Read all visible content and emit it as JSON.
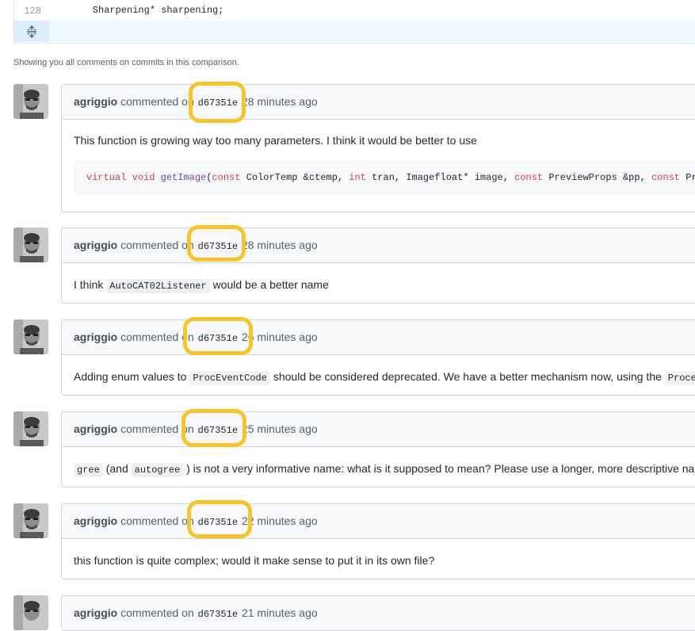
{
  "diff": {
    "line_number": "128",
    "code_line": "    Sharpening* sharpening;",
    "expand_icon": "unfold-icon"
  },
  "summary_text": "Showing you all comments on commits in this comparison.",
  "comments": [
    {
      "author": "agriggio",
      "action": "commented on",
      "sha": "d67351e",
      "time": "28 minutes ago",
      "text": "This function is growing way too many parameters. I think it would be better to use",
      "code": {
        "virtual": "virtual",
        "void": "void",
        "fn": "getImage",
        "p1": "(",
        "const1": "const",
        "t1": " ColorTemp &ctemp, ",
        "int": "int",
        "t2": " tran, Imagefloat* image, ",
        "const2": "const",
        "t3": " PreviewProps &pp, ",
        "const3": "const",
        "t4": " Pro"
      }
    },
    {
      "author": "agriggio",
      "action": "commented on",
      "sha": "d67351e",
      "time": "28 minutes ago",
      "text_before": "I think",
      "inline_code": "AutoCAT02Listener",
      "text_after": "would be a better name"
    },
    {
      "author": "agriggio",
      "action": "commented on",
      "sha": "d67351e",
      "time": "26 minutes ago",
      "text_before": "Adding enum values to",
      "inline_code": "ProcEventCode",
      "text_after": "should be considered deprecated. We have a better mechanism now, using the",
      "inline_code_2": "Proce"
    },
    {
      "author": "agriggio",
      "action": "commented on",
      "sha": "d67351e",
      "time": "25 minutes ago",
      "inline_code": "gree",
      "text_mid": "(and",
      "inline_code_2": "autogree",
      "text_after": ") is not a very informative name: what is it supposed to mean? Please use a longer, more descriptive nam"
    },
    {
      "author": "agriggio",
      "action": "commented on",
      "sha": "d67351e",
      "time": "22 minutes ago",
      "text": "this function is quite complex; would it make sense to put it in its own file?"
    },
    {
      "author": "agriggio",
      "action": "commented on",
      "sha": "d67351e",
      "time": "21 minutes ago"
    }
  ],
  "highlight_color": "#f7c52b"
}
